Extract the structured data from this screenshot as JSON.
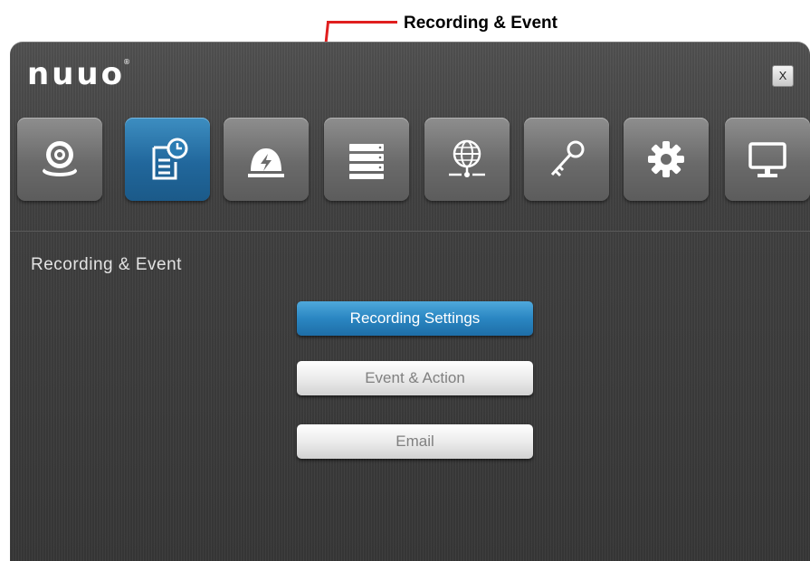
{
  "callout": {
    "label": "Recording & Event"
  },
  "window": {
    "logo": "nuuo",
    "logo_mark": "®",
    "close_label": "X"
  },
  "tabs": [
    {
      "icon": "camera-icon",
      "active": false
    },
    {
      "icon": "recording-schedule-icon",
      "active": true
    },
    {
      "icon": "alarm-icon",
      "active": false
    },
    {
      "icon": "storage-icon",
      "active": false
    },
    {
      "icon": "network-icon",
      "active": false
    },
    {
      "icon": "key-icon",
      "active": false
    },
    {
      "icon": "gear-icon",
      "active": false
    },
    {
      "icon": "monitor-icon",
      "active": false
    }
  ],
  "section": {
    "title": "Recording & Event"
  },
  "buttons": {
    "recording_settings": "Recording Settings",
    "event_action": "Event & Action",
    "email": "Email"
  },
  "colors": {
    "accent": "#2a86c2",
    "callout": "#e01e1e",
    "background": "#3a3a3a"
  }
}
